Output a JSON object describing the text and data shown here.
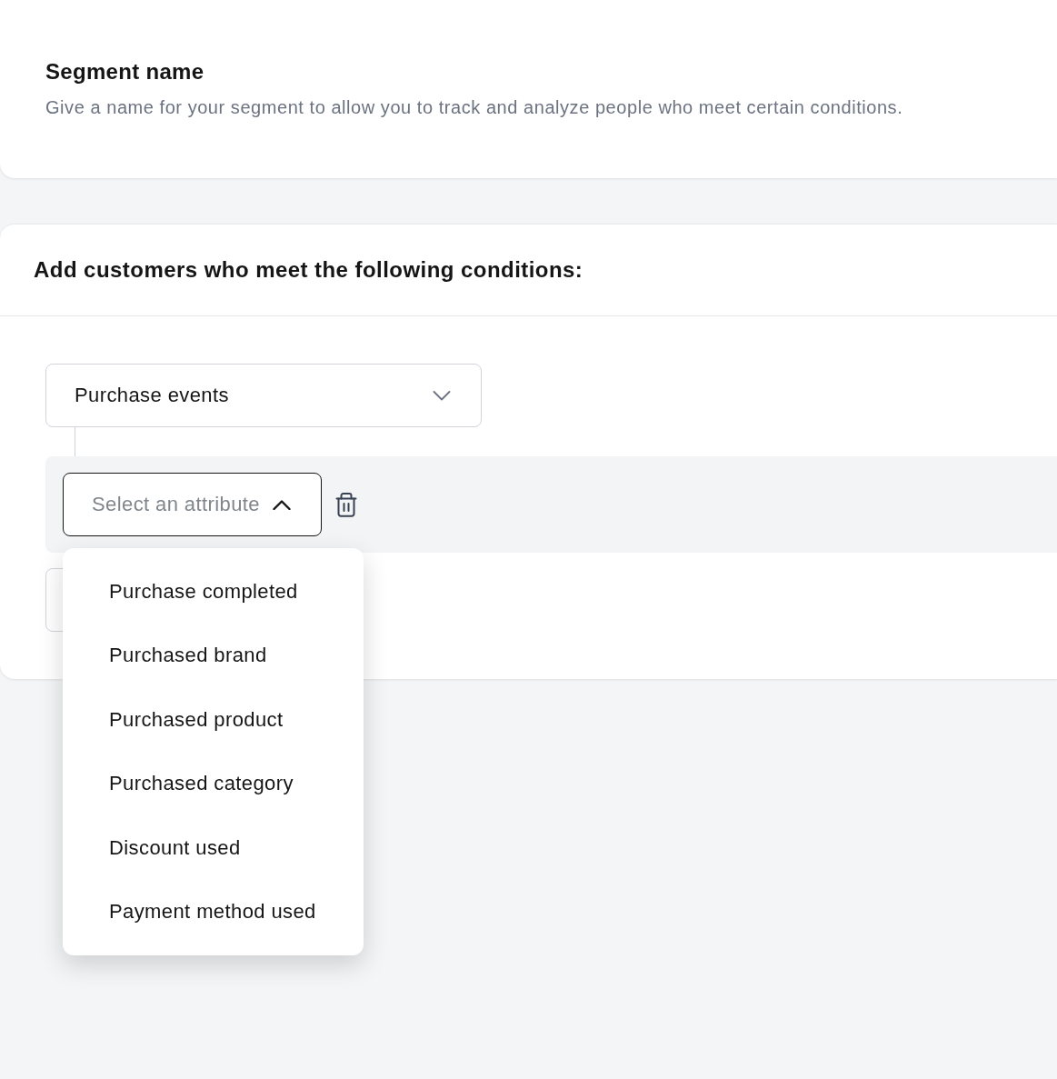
{
  "segment_name_card": {
    "title": "Segment name",
    "description": "Give a name for your segment to allow you to track and analyze people who meet certain conditions."
  },
  "conditions_card": {
    "title": "Add customers who meet the following conditions:",
    "event_select": {
      "value": "Purchase events",
      "expanded": false
    },
    "condition": {
      "attribute_select": {
        "placeholder": "Select an attribute",
        "expanded": true,
        "options": [
          {
            "label": "Purchase completed",
            "selected": false
          },
          {
            "label": "Purchased brand",
            "selected": false
          },
          {
            "label": "Purchased product",
            "selected": false
          },
          {
            "label": "Purchased category",
            "selected": false
          },
          {
            "label": "Discount used",
            "selected": false
          },
          {
            "label": "Payment method used",
            "selected": false
          }
        ]
      }
    }
  }
}
